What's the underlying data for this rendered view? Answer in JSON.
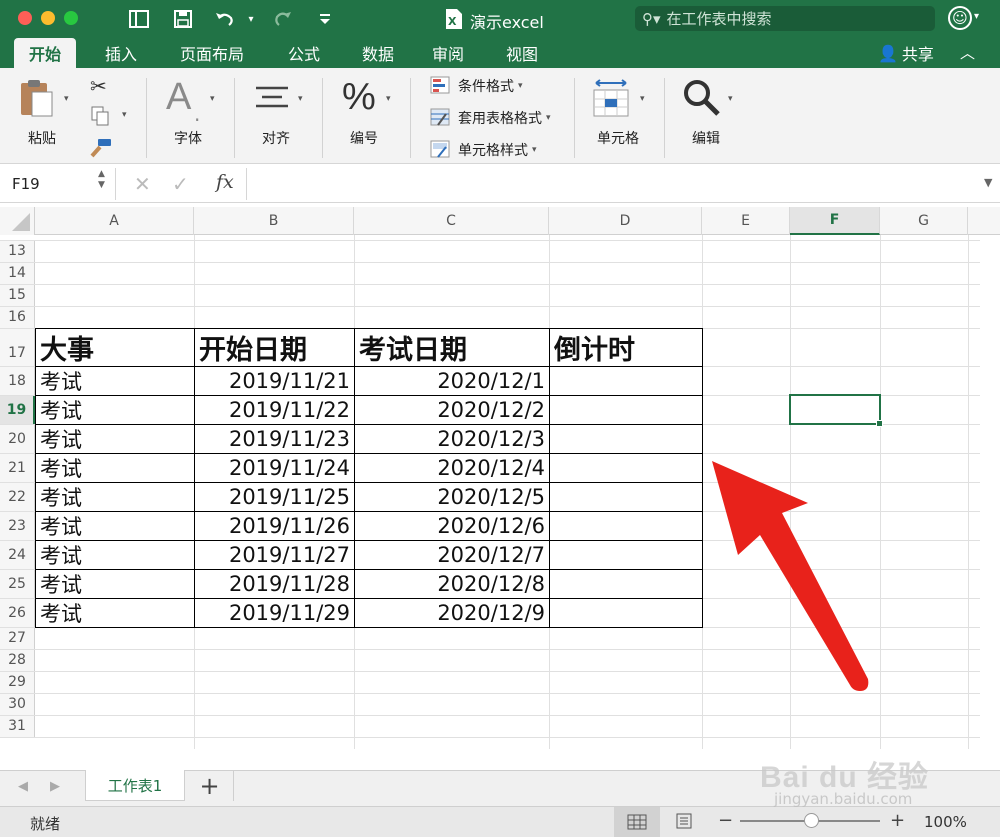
{
  "window": {
    "title": "演示excel",
    "search_placeholder": "在工作表中搜索"
  },
  "ribbon_tabs": [
    "开始",
    "插入",
    "页面布局",
    "公式",
    "数据",
    "审阅",
    "视图"
  ],
  "share_label": "共享",
  "ribbon": {
    "paste": "粘贴",
    "font": "字体",
    "align": "对齐",
    "number": "编号",
    "conditional_format": "条件格式",
    "table_format": "套用表格格式",
    "cell_style": "单元格样式",
    "cells": "单元格",
    "edit": "编辑"
  },
  "formula_bar": {
    "name_box": "F19",
    "fx": "fx",
    "value": ""
  },
  "columns": [
    "A",
    "B",
    "C",
    "D",
    "E",
    "F",
    "G"
  ],
  "row_numbers": [
    "13",
    "14",
    "15",
    "16",
    "17",
    "18",
    "19",
    "20",
    "21",
    "22",
    "23",
    "24",
    "25",
    "26",
    "27",
    "28",
    "29",
    "30",
    "31"
  ],
  "table": {
    "headers": [
      "大事",
      "开始日期",
      "考试日期",
      "倒计时"
    ],
    "rows": [
      [
        "考试",
        "2019/11/21",
        "2020/12/1",
        ""
      ],
      [
        "考试",
        "2019/11/22",
        "2020/12/2",
        ""
      ],
      [
        "考试",
        "2019/11/23",
        "2020/12/3",
        ""
      ],
      [
        "考试",
        "2019/11/24",
        "2020/12/4",
        ""
      ],
      [
        "考试",
        "2019/11/25",
        "2020/12/5",
        ""
      ],
      [
        "考试",
        "2019/11/26",
        "2020/12/6",
        ""
      ],
      [
        "考试",
        "2019/11/27",
        "2020/12/7",
        ""
      ],
      [
        "考试",
        "2019/11/28",
        "2020/12/8",
        ""
      ],
      [
        "考试",
        "2019/11/29",
        "2020/12/9",
        ""
      ]
    ]
  },
  "sheet_tabs": [
    "工作表1"
  ],
  "add_sheet": "+",
  "status": {
    "ready": "就绪",
    "zoom": "100%",
    "minus": "−",
    "plus": "+"
  },
  "watermark": {
    "brand": "Bai du 经验",
    "url": "jingyan.baidu.com"
  },
  "colors": {
    "excel_green": "#217346",
    "arrow_red": "#e8221b",
    "selection": "#217346"
  }
}
